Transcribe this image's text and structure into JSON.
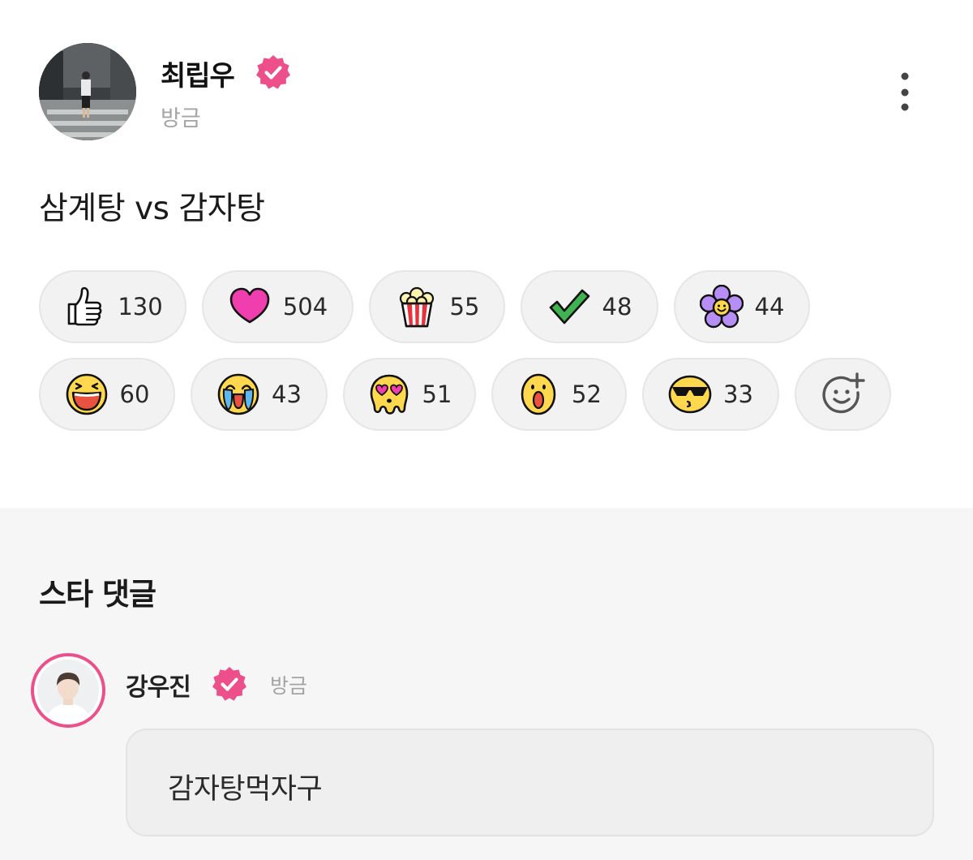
{
  "post": {
    "author_name": "최립우",
    "time": "방금",
    "text": "삼계탕 vs 감자탕",
    "reactions_row1": [
      {
        "icon": "thumbs-up-icon",
        "count": "130"
      },
      {
        "icon": "heart-icon",
        "count": "504"
      },
      {
        "icon": "popcorn-icon",
        "count": "55"
      },
      {
        "icon": "check-icon",
        "count": "48"
      },
      {
        "icon": "flower-icon",
        "count": "44"
      }
    ],
    "reactions_row2": [
      {
        "icon": "laughing-face-icon",
        "count": "60"
      },
      {
        "icon": "crying-face-icon",
        "count": "43"
      },
      {
        "icon": "melting-heart-eyes-face-icon",
        "count": "51"
      },
      {
        "icon": "surprised-face-icon",
        "count": "52"
      },
      {
        "icon": "sunglasses-face-icon",
        "count": "33"
      }
    ],
    "add_reaction_icon": "add-reaction-icon"
  },
  "comments": {
    "title": "스타 댓글",
    "items": [
      {
        "author": "강우진",
        "time": "방금",
        "text": "감자탕먹자구"
      }
    ]
  },
  "colors": {
    "verified": "#ec4f8a",
    "muted_text": "#a4a4a4",
    "chip_bg": "#f2f2f2",
    "comments_bg": "#f6f6f6"
  }
}
